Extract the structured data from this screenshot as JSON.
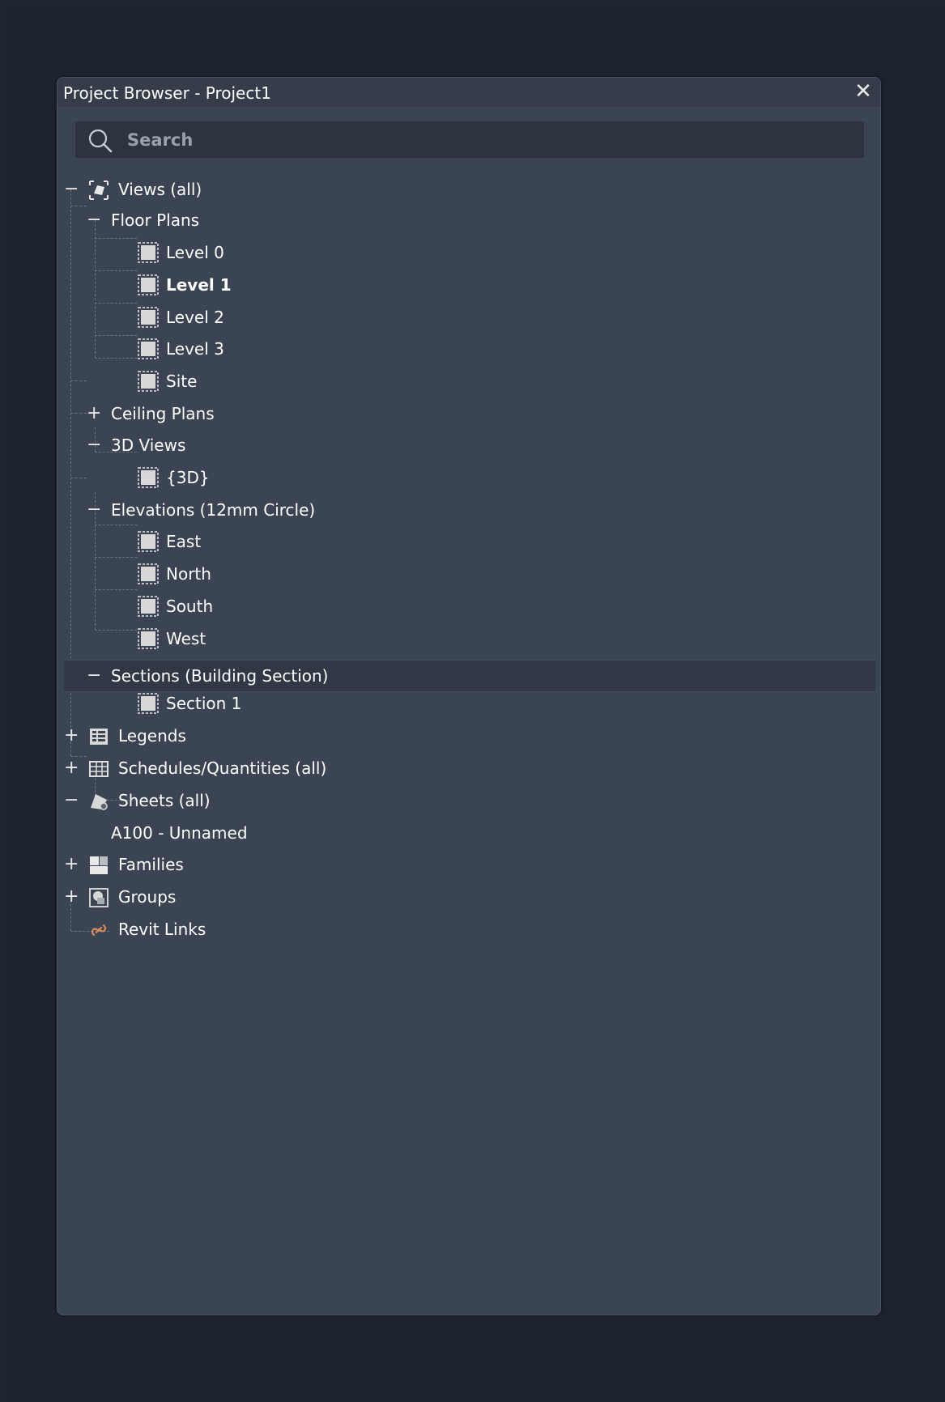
{
  "window": {
    "title": "Project Browser - Project1",
    "close_glyph": "✕"
  },
  "search": {
    "placeholder": "Search",
    "value": ""
  },
  "tree": {
    "views_all": {
      "label": "Views (all)",
      "expander": "−"
    },
    "floor_plans": {
      "label": "Floor Plans",
      "expander": "−"
    },
    "level_0": {
      "label": "Level 0"
    },
    "level_1": {
      "label": "Level 1"
    },
    "level_2": {
      "label": "Level 2"
    },
    "level_3": {
      "label": "Level 3"
    },
    "site": {
      "label": "Site"
    },
    "ceiling_plans": {
      "label": "Ceiling Plans",
      "expander": "+"
    },
    "views_3d": {
      "label": "3D Views",
      "expander": "−"
    },
    "view_3d": {
      "label": "{3D}"
    },
    "elevations": {
      "label": "Elevations (12mm Circle)",
      "expander": "−"
    },
    "east": {
      "label": "East"
    },
    "north": {
      "label": "North"
    },
    "south": {
      "label": "South"
    },
    "west": {
      "label": "West"
    },
    "sections": {
      "label": "Sections (Building Section)",
      "expander": "−"
    },
    "section_1": {
      "label": "Section 1"
    },
    "legends": {
      "label": "Legends",
      "expander": "+"
    },
    "schedules": {
      "label": "Schedules/Quantities (all)",
      "expander": "+"
    },
    "sheets": {
      "label": "Sheets (all)",
      "expander": "−"
    },
    "sheet_a100": {
      "label": "A100 - Unnamed"
    },
    "families": {
      "label": "Families",
      "expander": "+"
    },
    "groups": {
      "label": "Groups",
      "expander": "+"
    },
    "revit_links": {
      "label": "Revit Links"
    }
  },
  "colors": {
    "panel_bg": "#3b4453",
    "titlebar_bg": "#353d4b",
    "search_bg": "#2d3440",
    "text": "#ffffff",
    "link_icon": "#d98a5c"
  }
}
